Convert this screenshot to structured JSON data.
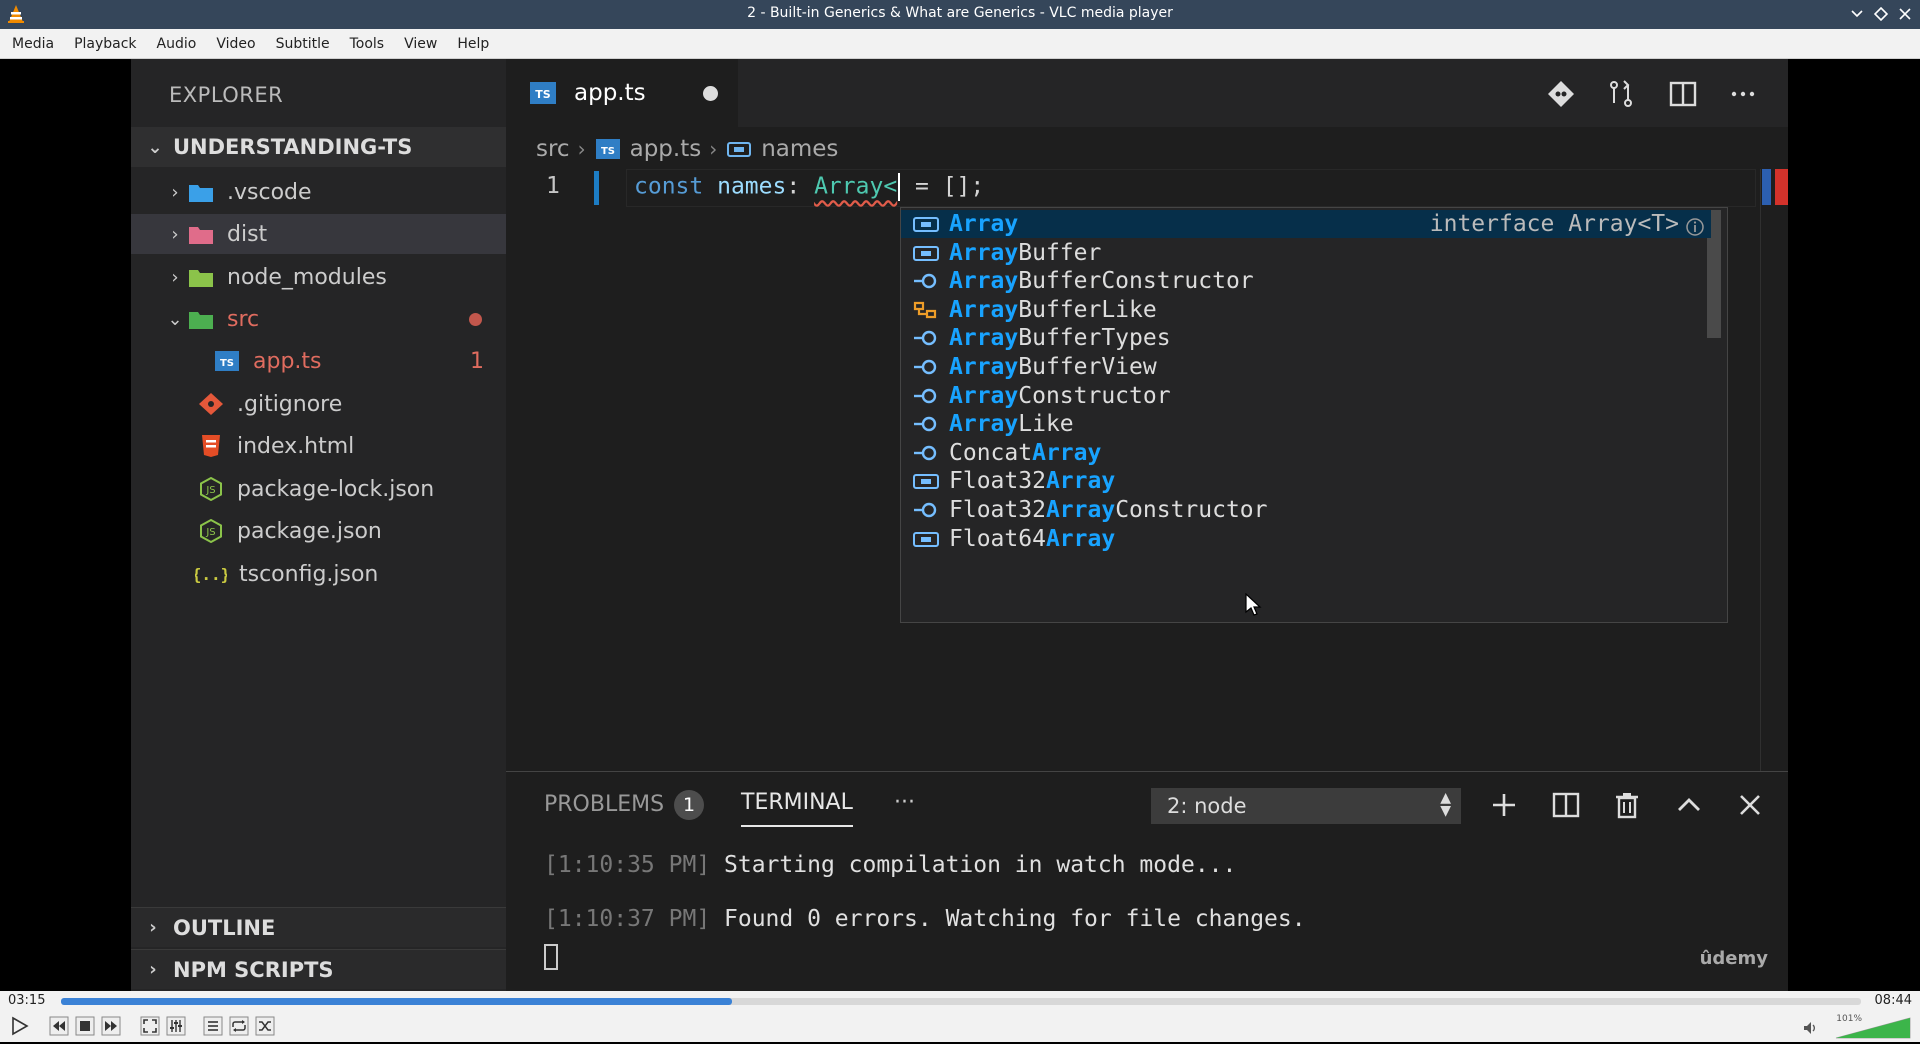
{
  "window": {
    "title": "2 - Built-in Generics & What are Generics - VLC media player"
  },
  "menubar": {
    "items": [
      "Media",
      "Playback",
      "Audio",
      "Video",
      "Subtitle",
      "Tools",
      "View",
      "Help"
    ]
  },
  "explorer": {
    "title": "EXPLORER",
    "folder": "UNDERSTANDING-TS",
    "items": [
      {
        "label": ".vscode",
        "icon": "vscode-folder-icon",
        "color": "#3aa0e8"
      },
      {
        "label": "dist",
        "icon": "dist-folder-icon",
        "color": "#e06c8a"
      },
      {
        "label": "node_modules",
        "icon": "node-folder-icon",
        "color": "#8bc34a"
      },
      {
        "label": "src",
        "icon": "src-folder-icon",
        "color": "#4caf50"
      },
      {
        "label": "app.ts",
        "icon": "typescript-file-icon",
        "badge": "1"
      },
      {
        "label": ".gitignore",
        "icon": "git-icon"
      },
      {
        "label": "index.html",
        "icon": "html-icon"
      },
      {
        "label": "package-lock.json",
        "icon": "node-json-icon"
      },
      {
        "label": "package.json",
        "icon": "node-json-icon"
      },
      {
        "label": "tsconfig.json",
        "icon": "json-icon"
      }
    ],
    "sections": [
      "OUTLINE",
      "NPM SCRIPTS"
    ]
  },
  "editor": {
    "tab_label": "app.ts",
    "breadcrumb": [
      "src",
      "app.ts",
      "names"
    ],
    "line_number": "1",
    "code": {
      "keyword": "const",
      "identifier": "names",
      "colon": ":",
      "type": "Array<",
      "rest": " = [];"
    }
  },
  "suggestions": {
    "active_detail": "interface Array<T>",
    "items": [
      {
        "pre": "",
        "match": "Array",
        "post": "",
        "icon": "interface-icon"
      },
      {
        "pre": "",
        "match": "Array",
        "post": "Buffer",
        "icon": "interface-icon"
      },
      {
        "pre": "",
        "match": "Array",
        "post": "BufferConstructor",
        "icon": "variable-icon"
      },
      {
        "pre": "",
        "match": "Array",
        "post": "BufferLike",
        "icon": "type-alias-icon"
      },
      {
        "pre": "",
        "match": "Array",
        "post": "BufferTypes",
        "icon": "variable-icon"
      },
      {
        "pre": "",
        "match": "Array",
        "post": "BufferView",
        "icon": "variable-icon"
      },
      {
        "pre": "",
        "match": "Array",
        "post": "Constructor",
        "icon": "variable-icon"
      },
      {
        "pre": "",
        "match": "Array",
        "post": "Like",
        "icon": "variable-icon"
      },
      {
        "pre": "Concat",
        "match": "Array",
        "post": "",
        "icon": "variable-icon"
      },
      {
        "pre": "Float32",
        "match": "Array",
        "post": "",
        "icon": "interface-icon"
      },
      {
        "pre": "Float32",
        "match": "Array",
        "post": "Constructor",
        "icon": "variable-icon"
      },
      {
        "pre": "Float64",
        "match": "Array",
        "post": "",
        "icon": "interface-icon"
      }
    ]
  },
  "panel": {
    "problems_label": "PROBLEMS",
    "problems_count": "1",
    "terminal_label": "TERMINAL",
    "more_label": "···",
    "terminal_select": "2: node",
    "lines": [
      {
        "time": "[1:10:35 PM]",
        "text": " Starting compilation in watch mode..."
      },
      {
        "time": "[1:10:37 PM]",
        "text": " Found 0 errors. Watching for file changes."
      }
    ],
    "watermark": "ûdemy"
  },
  "player": {
    "elapsed": "03:15",
    "total": "08:44",
    "progress": 0.3728,
    "volume_label": "101%"
  },
  "colors": {
    "vlc_titlebar": "#35465a",
    "accent_blue": "#18a3ff",
    "error_red": "#e06c5f"
  }
}
